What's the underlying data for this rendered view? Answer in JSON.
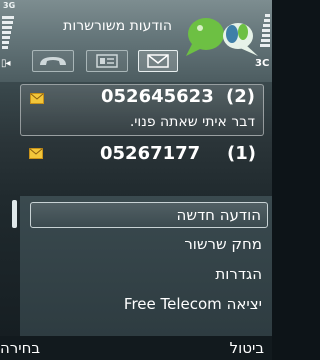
{
  "status": {
    "network_indicator": "3G",
    "signal_icon": "signal-strength-bars",
    "battery_icon": "battery-level-bars",
    "pager_right": "3C"
  },
  "app": {
    "title": "הודעות משורשרות",
    "logo_icon": "green-chat-bubbles-logo"
  },
  "tabs": [
    {
      "icon": "phone-handset-icon",
      "active": false
    },
    {
      "icon": "document-icon",
      "active": false
    },
    {
      "icon": "envelope-icon",
      "active": true
    }
  ],
  "messages": [
    {
      "icon": "envelope-icon",
      "number": "052645623",
      "count": "(2)",
      "preview": "דבר איתי שאתה פנוי.",
      "selected": true
    },
    {
      "icon": "envelope-icon",
      "number": "05267177",
      "count": "(1)",
      "selected": false
    }
  ],
  "menu": {
    "items": [
      {
        "label": "הודעה חדשה",
        "selected": true
      },
      {
        "label": "מחק שרשור",
        "selected": false
      },
      {
        "label": "הגדרות",
        "selected": false
      },
      {
        "label": "Free Telecom יציאה",
        "selected": false
      }
    ]
  },
  "softkeys": {
    "left_label": "ביטול",
    "right_label": "בחירה"
  },
  "colors": {
    "envelope": "#f2c63a",
    "logo_green": "#6dc043",
    "text": "#ffffff"
  }
}
